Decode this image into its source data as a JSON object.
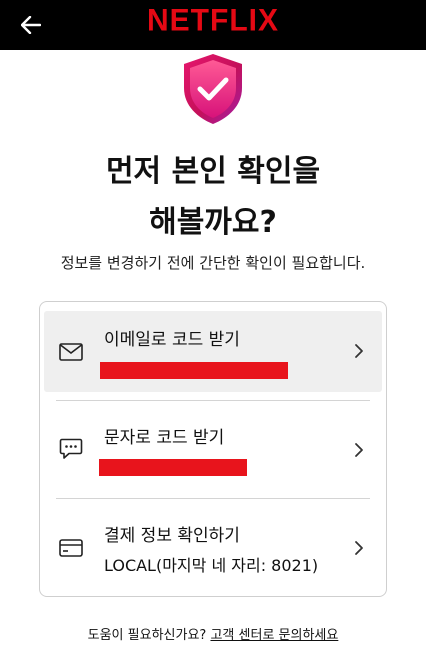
{
  "header": {
    "back_icon": "arrow-left-icon",
    "logo_text": "NETFLIX",
    "colors": {
      "bar": "#000000",
      "logo": "#e50914"
    }
  },
  "hero": {
    "shield_icon": "shield-check-icon",
    "title_line1": "먼저 본인 확인을",
    "title_line2": "해볼까요?",
    "subtitle": "정보를 변경하기 전에 간단한 확인이 필요합니다."
  },
  "options": [
    {
      "icon": "mail-icon",
      "label": "이메일로 코드 받기",
      "detail_redacted": true,
      "chevron": "chevron-right-icon"
    },
    {
      "icon": "sms-icon",
      "label": "문자로 코드 받기",
      "detail_redacted": true,
      "chevron": "chevron-right-icon"
    },
    {
      "icon": "credit-card-icon",
      "label": "결제 정보 확인하기",
      "detail": "LOCAL(마지막 네 자리: 8021)",
      "chevron": "chevron-right-icon"
    }
  ],
  "footer": {
    "help_text": "도움이 필요하신가요?",
    "help_link": "고객 센터로 문의하세요"
  },
  "colors": {
    "redaction": "#e8141c",
    "highlight": "#efefef",
    "border": "#cfcfcf"
  }
}
